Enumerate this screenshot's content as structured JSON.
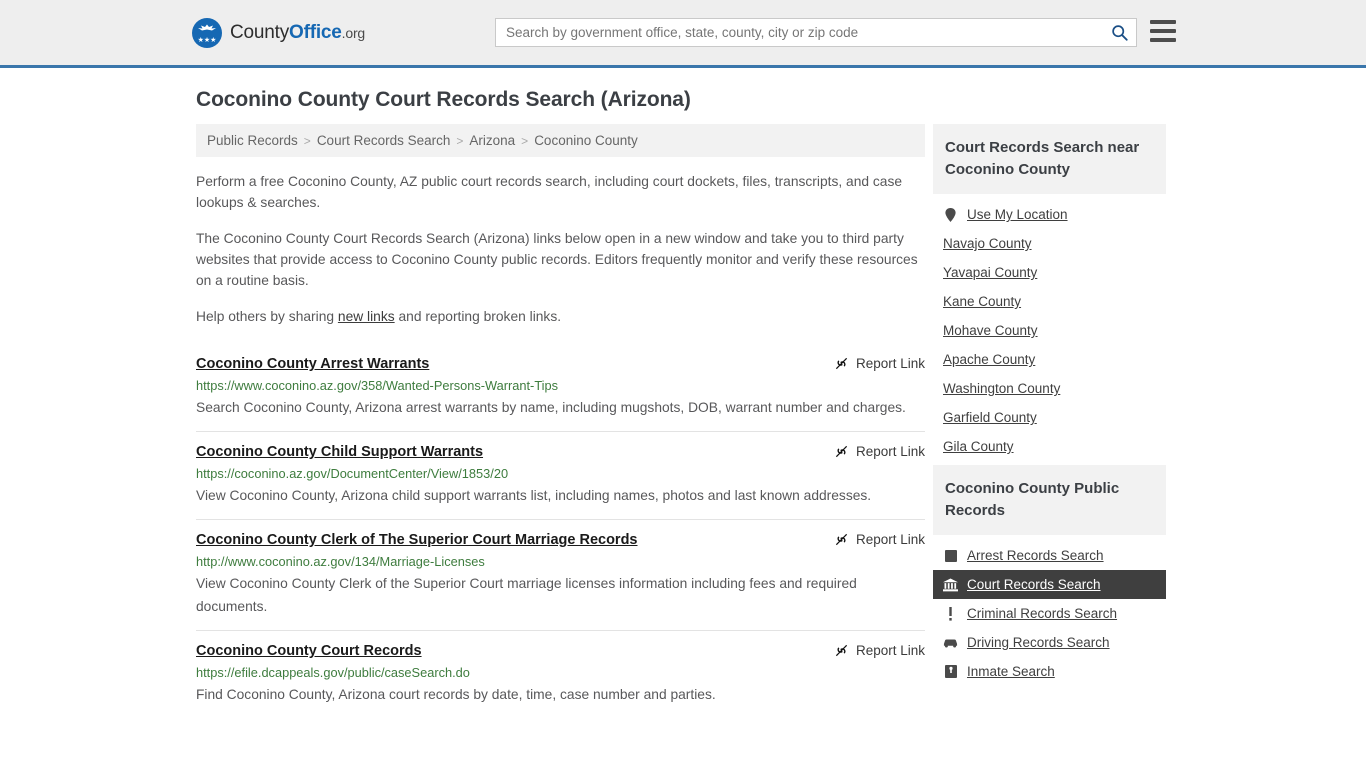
{
  "header": {
    "brand": {
      "part1": "County",
      "part2": "Office",
      "part3": ".org",
      "seal_icon": "eagle-seal-icon"
    },
    "search": {
      "placeholder": "Search by government office, state, county, city or zip code",
      "value": "",
      "button_icon": "search-icon"
    },
    "menu_icon": "hamburger-menu-icon",
    "accent_color": "#3a76ab",
    "background_color": "#eeeeee"
  },
  "page_title": "Coconino County Court Records Search (Arizona)",
  "breadcrumb": {
    "separator": ">",
    "items": [
      {
        "label": "Public Records"
      },
      {
        "label": "Court Records Search"
      },
      {
        "label": "Arizona"
      },
      {
        "label": "Coconino County"
      }
    ]
  },
  "intro": {
    "p1": "Perform a free Coconino County, AZ public court records search, including court dockets, files, transcripts, and case lookups & searches.",
    "p2": "The Coconino County Court Records Search (Arizona) links below open in a new window and take you to third party websites that provide access to Coconino County public records. Editors frequently monitor and verify these resources on a routine basis.",
    "p3_before": "Help others by sharing ",
    "p3_link": "new links",
    "p3_after": " and reporting broken links."
  },
  "results": {
    "report_label": "Report Link",
    "report_icon": "broken-link-icon",
    "items": [
      {
        "title": "Coconino County Arrest Warrants",
        "url": "https://www.coconino.az.gov/358/Wanted-Persons-Warrant-Tips",
        "description": "Search Coconino County, Arizona arrest warrants by name, including mugshots, DOB, warrant number and charges."
      },
      {
        "title": "Coconino County Child Support Warrants",
        "url": "https://coconino.az.gov/DocumentCenter/View/1853/20",
        "description": "View Coconino County, Arizona child support warrants list, including names, photos and last known addresses."
      },
      {
        "title": "Coconino County Clerk of The Superior Court Marriage Records",
        "url": "http://www.coconino.az.gov/134/Marriage-Licenses",
        "description": "View Coconino County Clerk of the Superior Court marriage licenses information including fees and required documents."
      },
      {
        "title": "Coconino County Court Records",
        "url": "https://efile.dcappeals.gov/public/caseSearch.do",
        "description": "Find Coconino County, Arizona court records by date, time, case number and parties."
      }
    ]
  },
  "sidebar": {
    "near_panel": {
      "title": "Court Records Search near Coconino County",
      "items": [
        {
          "label": "Use My Location",
          "icon": "map-pin-icon"
        },
        {
          "label": "Navajo County",
          "icon": ""
        },
        {
          "label": "Yavapai County",
          "icon": ""
        },
        {
          "label": "Kane County",
          "icon": ""
        },
        {
          "label": "Mohave County",
          "icon": ""
        },
        {
          "label": "Apache County",
          "icon": ""
        },
        {
          "label": "Washington County",
          "icon": ""
        },
        {
          "label": "Garfield County",
          "icon": ""
        },
        {
          "label": "Gila County",
          "icon": ""
        }
      ]
    },
    "public_records_panel": {
      "title": "Coconino County Public Records",
      "items": [
        {
          "label": "Arrest Records Search",
          "icon": "square-badge-icon",
          "active": false
        },
        {
          "label": "Court Records Search",
          "icon": "courthouse-icon",
          "active": true
        },
        {
          "label": "Criminal Records Search",
          "icon": "exclamation-icon",
          "active": false
        },
        {
          "label": "Driving Records Search",
          "icon": "car-icon",
          "active": false
        },
        {
          "label": "Inmate Search",
          "icon": "jail-icon",
          "active": false
        }
      ]
    }
  }
}
